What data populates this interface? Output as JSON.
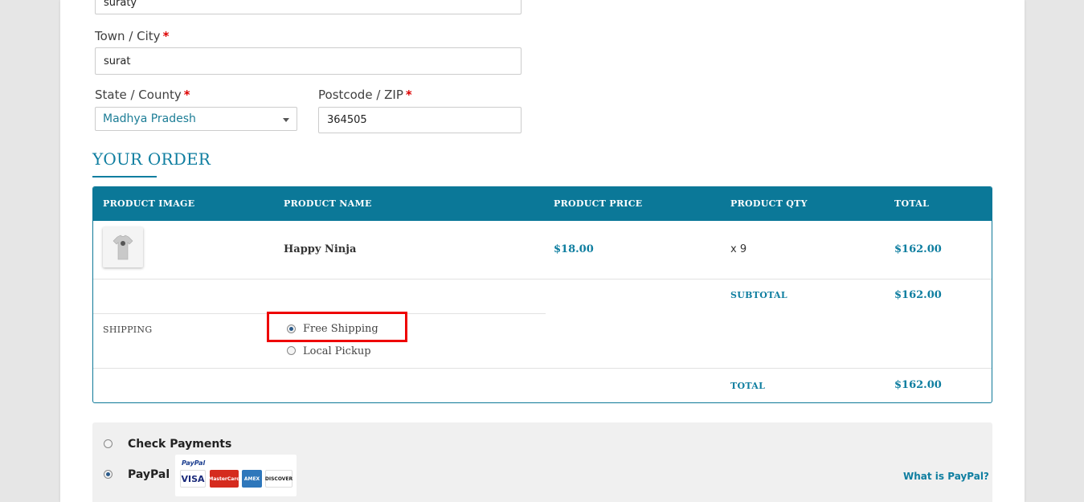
{
  "form": {
    "address_value": "suraty",
    "town_label": "Town / City",
    "town_value": "surat",
    "state_label": "State / County",
    "state_value": "Madhya Pradesh",
    "postcode_label": "Postcode / ZIP",
    "postcode_value": "364505",
    "required_mark": "*"
  },
  "order": {
    "heading": "YOUR ORDER",
    "columns": [
      "PRODUCT IMAGE",
      "PRODUCT NAME",
      "PRODUCT PRICE",
      "PRODUCT QTY",
      "TOTAL"
    ],
    "item": {
      "name": "Happy Ninja",
      "price": "$18.00",
      "qty": "x 9",
      "total": "$162.00"
    },
    "subtotal_label": "SUBTOTAL",
    "subtotal_value": "$162.00",
    "shipping_label": "SHIPPING",
    "shipping_options": [
      {
        "label": "Free Shipping",
        "selected": true
      },
      {
        "label": "Local Pickup",
        "selected": false
      }
    ],
    "total_label": "TOTAL",
    "total_value": "$162.00"
  },
  "payment": {
    "methods": [
      {
        "label": "Check Payments",
        "selected": false
      },
      {
        "label": "PayPal",
        "selected": true
      }
    ],
    "paypal_logo_text": "PayPal",
    "cards": [
      "VISA",
      "MasterCard",
      "AMEX",
      "DISCOVER"
    ],
    "what_is_paypal": "What is PayPal?"
  },
  "colors": {
    "accent": "#0b7898",
    "highlight": "#e00000",
    "page_bg": "#e6e6e6"
  }
}
